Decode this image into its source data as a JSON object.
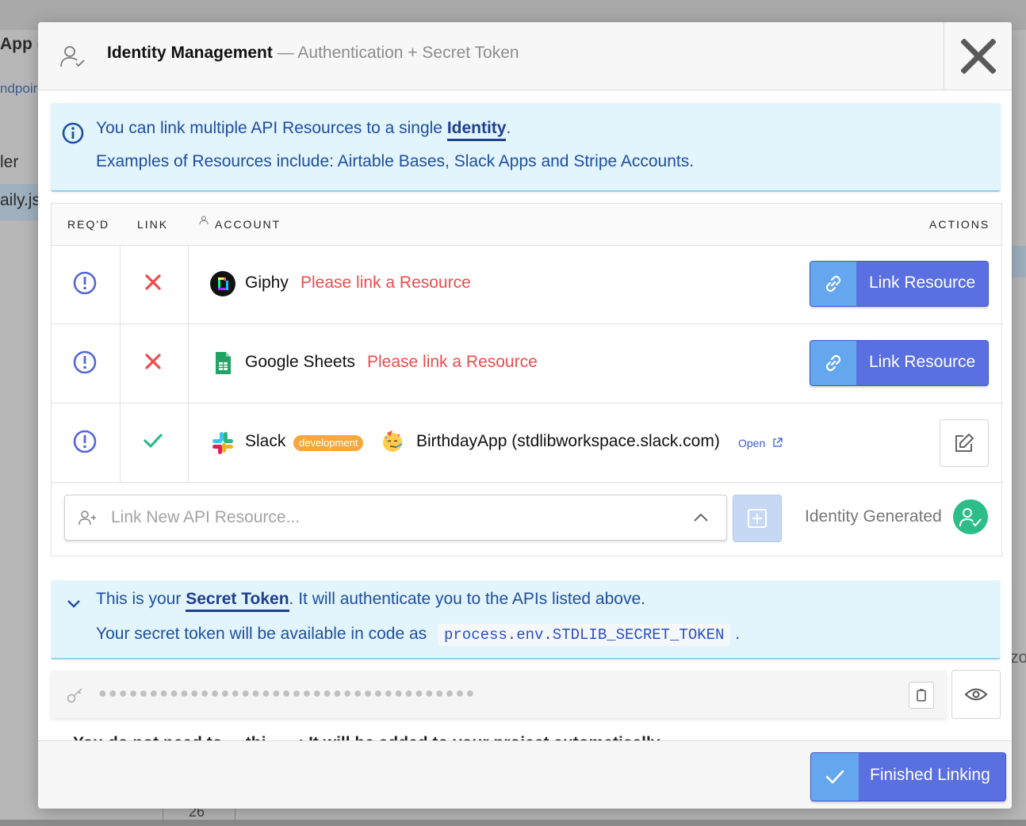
{
  "background": {
    "app_title_fragment": "App (",
    "endpoints_fragment": "ndpoir",
    "handler_fragment": "ler",
    "file_fragment": "aily.js",
    "right_fragment": "zo",
    "line_number": "26"
  },
  "header": {
    "title": "Identity Management",
    "subtitle": " — Authentication + Secret Token",
    "close_icon": "close-icon"
  },
  "info": {
    "line1_prefix": "You can link multiple API Resources to a single ",
    "line1_highlight": "Identity",
    "line1_suffix": ".",
    "line2": "Examples of Resources include: Airtable Bases, Slack Apps and Stripe Accounts."
  },
  "table": {
    "headers": {
      "required": "REQ'D",
      "link": "LINK",
      "account": "ACCOUNT",
      "actions": "ACTIONS"
    },
    "rows": [
      {
        "service": "Giphy",
        "status": "Please link a Resource",
        "linked": false,
        "action": "Link Resource"
      },
      {
        "service": "Google Sheets",
        "status": "Please link a Resource",
        "linked": false,
        "action": "Link Resource"
      },
      {
        "service": "Slack",
        "badge": "development",
        "account": "BirthdayApp (stdlibworkspace.slack.com)",
        "open_label": "Open",
        "linked": true
      }
    ],
    "add": {
      "placeholder": "Link New API Resource...",
      "identity_status": "Identity Generated"
    }
  },
  "secret": {
    "line1_prefix": "This is your ",
    "line1_highlight": "Secret Token",
    "line1_suffix": ". It will authenticate you to the APIs listed above.",
    "line2_prefix": "Your secret token will be available in code as ",
    "code": "process.env.STDLIB_SECRET_TOKEN",
    "line2_suffix": " .",
    "token_masked": "●●●●●●●●●●●●●●●●●●●●●●●●●●●●●●●●●●●●●",
    "cut_off_text": "You do not need to ... thi... ...: It will be added to your project automatically"
  },
  "footer": {
    "finish_label": "Finished Linking"
  },
  "colors": {
    "primary": "#5a6fe0",
    "primary_icon": "#64a7ee",
    "info_bg": "#e2f4fc",
    "info_text": "#1f4fa0",
    "warning": "#ef4b4b",
    "success": "#2dbd88",
    "badge": "#f6a83b"
  }
}
